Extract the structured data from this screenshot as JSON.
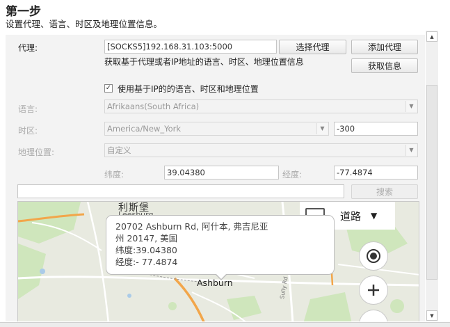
{
  "page": {
    "title": "第一步",
    "subtitle": "设置代理、语言、时区及地理位置信息。"
  },
  "proxy": {
    "label": "代理:",
    "value": "[SOCKS5]192.168.31.103:5000",
    "select_button": "选择代理",
    "add_button": "添加代理",
    "info_text": "获取基于代理或者IP地址的语言、时区、地理位置信息",
    "fetch_button": "获取信息"
  },
  "checkbox": {
    "label": "使用基于IP的的语言、时区和地理位置",
    "checked": true,
    "mark": "✓"
  },
  "language": {
    "label": "语言:",
    "value": "Afrikaans(South Africa)"
  },
  "timezone": {
    "label": "时区:",
    "value": "America/New_York",
    "offset": "-300"
  },
  "geo": {
    "label": "地理位置:",
    "value": "自定义",
    "lat_label": "纬度:",
    "lat_value": "39.04380",
    "lng_label": "经度:",
    "lng_value": "-77.4874"
  },
  "search": {
    "value": "",
    "button": "搜索"
  },
  "map": {
    "city_top": "利斯堡",
    "city_top_sub": "Leesburg",
    "town": "Ashburn",
    "map_type": "道路",
    "popup": {
      "line1": "20702 Ashburn Rd, 阿什本, 弗吉尼亚",
      "line2": "州 20147, 美国",
      "line3": "纬度:39.04380",
      "line4": "经度:- 77.4874"
    },
    "road_label": "Sully Rd",
    "colors": {
      "map_bg": "#e8eae0",
      "park": "#c8e6b0",
      "road_orange": "#f2a64a",
      "road_white": "#ffffff"
    }
  },
  "icons": {
    "layers": "layers-icon",
    "locate": "locate-icon",
    "zoom_in": "zoom-in-icon",
    "scroll_up": "scroll-up-arrow-icon",
    "scroll_down": "scroll-down-arrow-icon"
  }
}
